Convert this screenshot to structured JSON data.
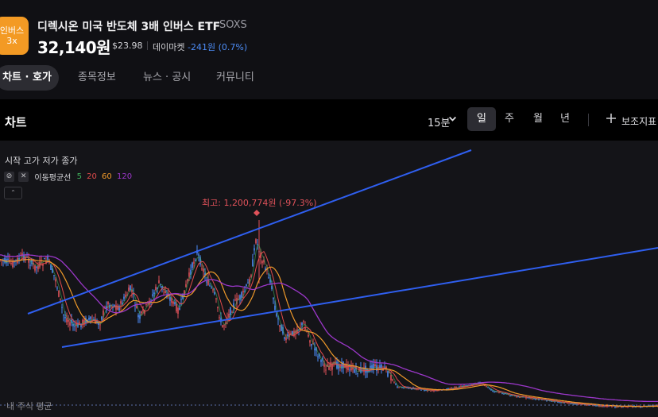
{
  "header": {
    "logo_line1": "인버스",
    "logo_line2": "3x",
    "stock_name": "디렉시온 미국 반도체 3배 인버스 ETF",
    "stock_code": "SOXS",
    "price": "32,140원",
    "usd_price": "$23.98",
    "daymarket_label": "데이마켓",
    "daymarket_change": "-241원 (0.7%)"
  },
  "tabs": [
    {
      "label": "차트 · 호가",
      "active": true
    },
    {
      "label": "종목정보",
      "active": false
    },
    {
      "label": "뉴스 · 공시",
      "active": false
    },
    {
      "label": "커뮤니티",
      "active": false
    }
  ],
  "toolbar": {
    "title": "차트",
    "interval": "15분",
    "periods": [
      "일",
      "주",
      "월",
      "년"
    ],
    "active_period": "일",
    "indicator_label": "보조지표"
  },
  "chart": {
    "ohlc_legend": "시작 고가 저가 종가",
    "ma_label": "이동평균선",
    "ma_periods": [
      {
        "value": "5",
        "color": "#3fae5a"
      },
      {
        "value": "20",
        "color": "#e04b4b"
      },
      {
        "value": "60",
        "color": "#f09a2a"
      },
      {
        "value": "120",
        "color": "#9b37c9"
      }
    ],
    "high_label": "최고: 1,200,774원 (-97.3%)",
    "avg_label": "내 주식 평균",
    "colors": {
      "up": "#e0525a",
      "down": "#4d8df7",
      "trendline": "#2f5ff0"
    }
  }
}
